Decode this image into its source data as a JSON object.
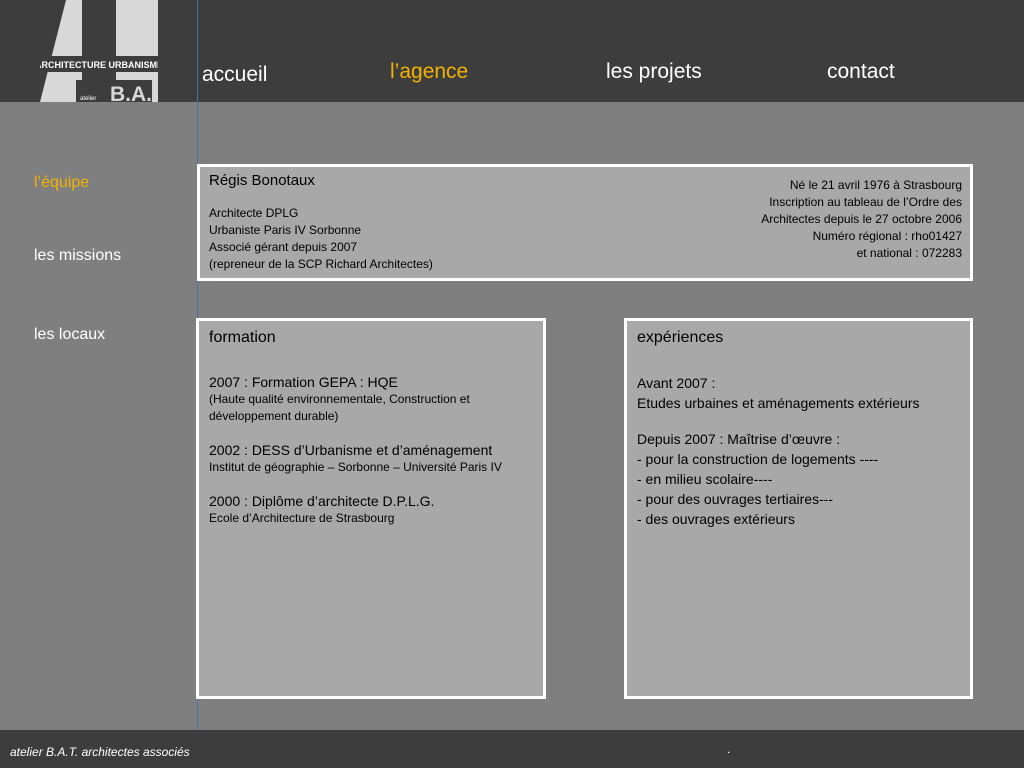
{
  "logo": {
    "line1": "ARCHITECTURE URBANISME",
    "small": "atelier",
    "mark": "B.A.T."
  },
  "nav": {
    "items": [
      {
        "label": "accueil"
      },
      {
        "label": "l’agence"
      },
      {
        "label": "les projets"
      },
      {
        "label": "contact"
      }
    ]
  },
  "sidebar": {
    "items": [
      {
        "label": "l’équipe"
      },
      {
        "label": "les missions"
      },
      {
        "label": "les locaux"
      }
    ]
  },
  "profile": {
    "name": "Régis Bonotaux",
    "left_lines": [
      "Architecte DPLG",
      "Urbaniste Paris IV Sorbonne",
      "Associé gérant depuis 2007",
      "(repreneur de la SCP Richard Architectes)"
    ],
    "right_lines": [
      "Né le 21 avril 1976 à Strasbourg",
      "Inscription au tableau de l’Ordre des",
      "Architectes depuis le 27 octobre 2006",
      "Numéro régional : rho01427",
      "et national : 072283"
    ]
  },
  "formation": {
    "title": "formation",
    "entries": [
      {
        "title": "2007 : Formation GEPA : HQE",
        "detail": "(Haute qualité environnementale, Construction et développement durable)"
      },
      {
        "title": "2002 : DESS d’Urbanisme et d’aménagement",
        "detail": "Institut de géographie – Sorbonne – Université Paris IV"
      },
      {
        "title": "2000 : Diplôme d’architecte D.P.L.G.",
        "detail": "Ecole d’Architecture de Strasbourg"
      }
    ]
  },
  "experiences": {
    "title": "expériences",
    "block1": [
      "Avant 2007 :",
      "Etudes urbaines et aménagements extérieurs"
    ],
    "block2": [
      "Depuis 2007 : Maîtrise d’œuvre :",
      "- pour la construction de logements ----",
      "- en milieu scolaire----",
      "- pour des ouvrages tertiaires---",
      "- des ouvrages extérieurs"
    ]
  },
  "footer": {
    "text": "atelier B.A.T. architectes associés",
    "dot": "."
  },
  "colors": {
    "header_bg": "#3d3d3d",
    "body_bg": "#7f7f7f",
    "panel_bg": "#a8a8a8",
    "accent": "#f2b300",
    "divider": "#4a6fa8"
  }
}
